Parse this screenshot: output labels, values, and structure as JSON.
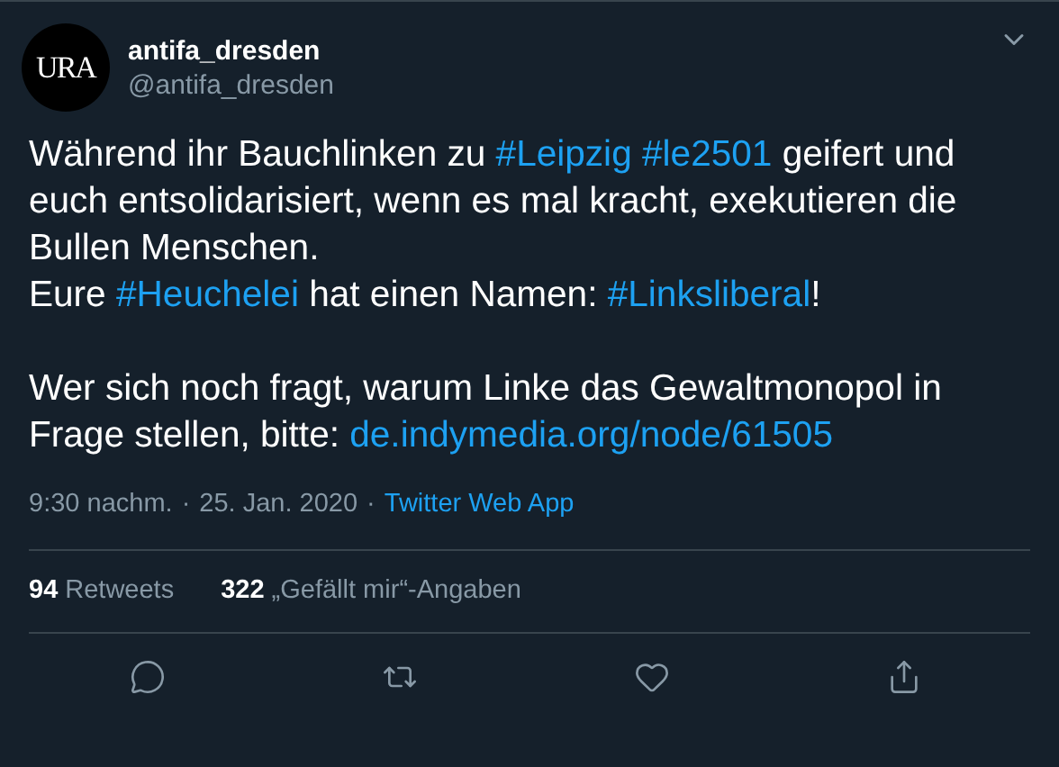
{
  "author": {
    "avatar_text": "URA",
    "name": "antifa_dresden",
    "handle": "@antifa_dresden"
  },
  "body": [
    {
      "lines": [
        {
          "segments": [
            {
              "kind": "text",
              "text": "Während ihr Bauchlinken zu "
            },
            {
              "kind": "hashtag",
              "text": "#Leipzig"
            },
            {
              "kind": "space"
            },
            {
              "kind": "hashtag",
              "text": "#le2501"
            },
            {
              "kind": "text",
              "text": " geifert und euch entsolidarisiert, wenn es mal kracht, exekutieren die Bullen Menschen."
            }
          ]
        },
        {
          "segments": [
            {
              "kind": "text",
              "text": "Eure "
            },
            {
              "kind": "hashtag",
              "text": "#Heuchelei"
            },
            {
              "kind": "text",
              "text": " hat einen Namen: "
            },
            {
              "kind": "hashtag",
              "text": "#Linksliberal"
            },
            {
              "kind": "text",
              "text": "!"
            }
          ]
        }
      ]
    },
    {
      "lines": [
        {
          "segments": [
            {
              "kind": "text",
              "text": "Wer sich noch fragt, warum Linke das Gewaltmonopol in Frage stellen, bitte: "
            },
            {
              "kind": "link",
              "text": "de.indymedia.org/node/61505"
            }
          ]
        }
      ]
    }
  ],
  "meta": {
    "time": "9:30 nachm.",
    "separator": "·",
    "date": "25. Jan. 2020",
    "source": "Twitter Web App"
  },
  "stats": [
    {
      "count": "94",
      "label": "Retweets"
    },
    {
      "count": "322",
      "label": "„Gefällt mir“-Angaben"
    }
  ],
  "actions": [
    {
      "kind": "reply"
    },
    {
      "kind": "retweet"
    },
    {
      "kind": "like"
    },
    {
      "kind": "share"
    }
  ]
}
